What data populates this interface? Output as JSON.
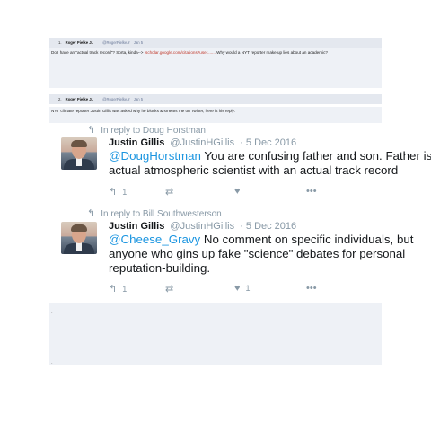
{
  "posts": [
    {
      "number": "1.",
      "author": "Roger Pielke Jr.",
      "handle": "@RogerPielkeJr",
      "date": "Jan 5",
      "text_before": "Do I have an \"actual track record\"? Sorta, kinda--> ",
      "link": ".scholar.google.com/citations?user.......",
      "text_after": " Why would a NYT reporter make up lies about an academic?"
    },
    {
      "number": "2.",
      "author": "Roger Pielke Jr.",
      "handle": "@RogerPielkeJr",
      "date": "Jan 5",
      "text": "NYT climate reporter Justin Gillis was asked why he blocks & smears me on Twitter, here is his reply:"
    }
  ],
  "tweets": [
    {
      "reply_to": "In reply to Doug Horstman",
      "name": "Justin Gillis",
      "handle": "@JustinHGillis",
      "date": "· 5 Dec 2016",
      "mention": "@DougHorstman",
      "text": " You are confusing father and son. Father is an actual atmospheric scientist with an actual track record",
      "retweets": "1",
      "likes": ""
    },
    {
      "reply_to": "In reply to Bill Southwesterson",
      "name": "Justin Gillis",
      "handle": "@JustinHGillis",
      "date": "· 5 Dec 2016",
      "mention": "@Cheese_Gravy",
      "text": " No comment on specific individuals, but anyone who gins up fake \"science\" debates for personal reputation-building.",
      "retweets": "1",
      "likes": "1"
    }
  ],
  "lower_marks": [
    "-",
    "-",
    "-",
    "-"
  ],
  "icons": {
    "reply": "reply-arrow-icon",
    "retweet": "retweet-icon",
    "like": "heart-icon",
    "more": "more-dots-icon"
  },
  "colors": {
    "mention": "#1b95e0",
    "link": "#c0392b",
    "muted": "#8899a6"
  }
}
